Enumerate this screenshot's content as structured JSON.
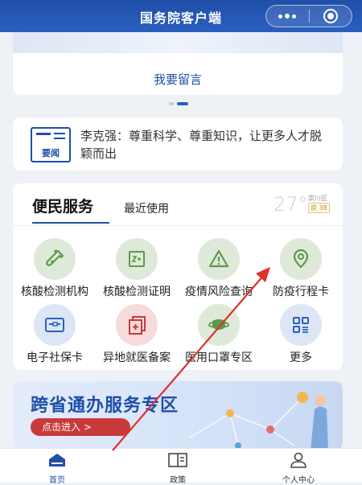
{
  "header": {
    "title": "国务院客户端"
  },
  "message": {
    "label": "我要留言"
  },
  "news": {
    "icon_label": "要闻",
    "headline": "李克强：尊重科学、尊重知识，让更多人才脱颖而出"
  },
  "services": {
    "tabs": [
      {
        "label": "便民服务"
      },
      {
        "label": "最近使用"
      }
    ],
    "weather": {
      "temperature": "27°",
      "city": "崇川区",
      "aqi": "良 38"
    },
    "items": [
      {
        "label": "核酸检测机构",
        "icon": "test-tube-icon"
      },
      {
        "label": "核酸检测证明",
        "icon": "certificate-icon"
      },
      {
        "label": "疫情风险查询",
        "icon": "warning-icon"
      },
      {
        "label": "防疫行程卡",
        "icon": "location-pin-icon"
      },
      {
        "label": "电子社保卡",
        "icon": "id-card-icon"
      },
      {
        "label": "异地就医备案",
        "icon": "medical-record-icon"
      },
      {
        "label": "医用口罩专区",
        "icon": "mask-icon"
      },
      {
        "label": "更多",
        "icon": "grid-more-icon"
      }
    ]
  },
  "banner": {
    "title": "跨省通办服务专区",
    "button_label": "点击进入 >"
  },
  "tabbar": {
    "items": [
      {
        "label": "首页",
        "icon": "home-icon",
        "active": true
      },
      {
        "label": "政策",
        "icon": "book-icon",
        "active": false
      },
      {
        "label": "个人中心",
        "icon": "user-icon",
        "active": false
      }
    ]
  },
  "colors": {
    "primary": "#1f4fa8",
    "green_icon_bg": "#dfe9d9",
    "green_icon": "#5a9a4a",
    "red_icon_bg": "#f7dada",
    "blue_icon_bg": "#dde6f5",
    "annotation_arrow": "#e0302a"
  }
}
